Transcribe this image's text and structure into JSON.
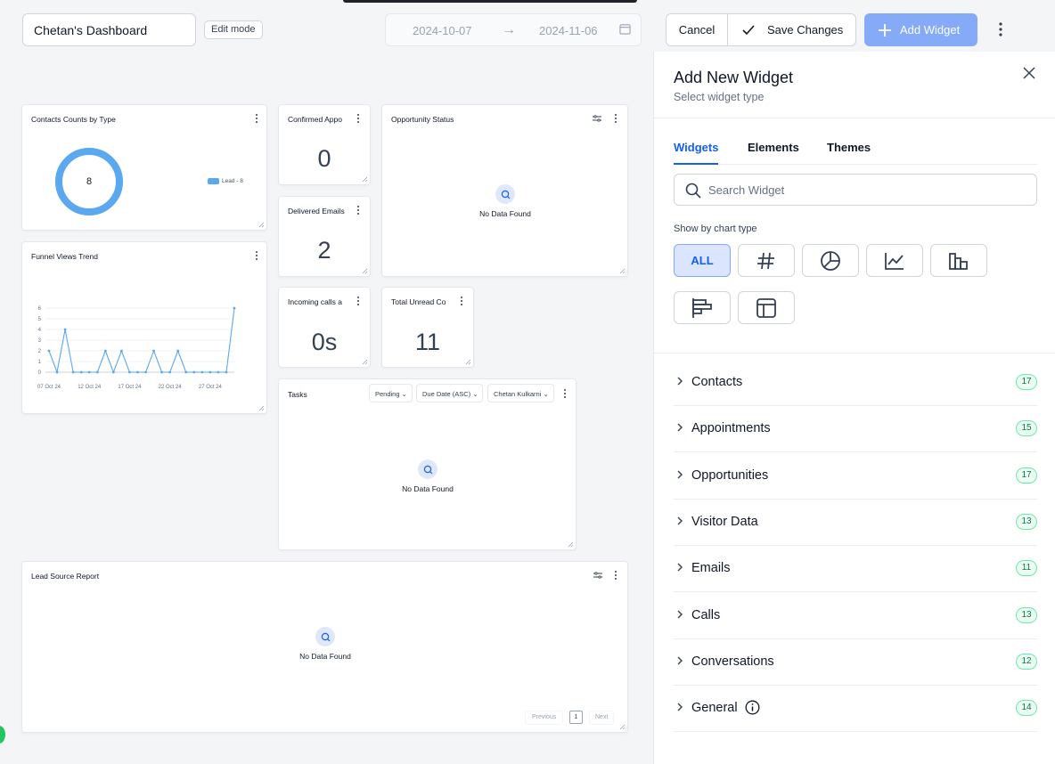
{
  "header": {
    "dashboard_name": "Chetan's Dashboard",
    "edit_mode": "Edit mode",
    "date_start": "2024-10-07",
    "date_end": "2024-11-06",
    "cancel": "Cancel",
    "save": "Save Changes",
    "add_widget": "Add Widget"
  },
  "widgets": {
    "contacts_by_type": {
      "title": "Contacts Counts by Type",
      "total": "8",
      "legend": "Lead - 8"
    },
    "confirmed_appts": {
      "title": "Confirmed Appo",
      "value": "0"
    },
    "opportunity_status": {
      "title": "Opportunity Status",
      "empty": "No Data Found"
    },
    "delivered_emails": {
      "title": "Delivered Emails",
      "value": "2"
    },
    "funnel_views": {
      "title": "Funnel Views Trend"
    },
    "incoming_calls": {
      "title": "Incoming calls a",
      "value": "0s"
    },
    "total_unread": {
      "title": "Total Unread Co",
      "value": "11"
    },
    "tasks": {
      "title": "Tasks",
      "filter_status": "Pending",
      "filter_sort": "Due Date (ASC)",
      "filter_user": "Chetan Kulkarni",
      "empty": "No Data Found"
    },
    "lead_source": {
      "title": "Lead Source Report",
      "empty": "No Data Found",
      "prev": "Previous",
      "page": "1",
      "next": "Next"
    }
  },
  "chart_data": {
    "type": "line",
    "title": "Funnel Views Trend",
    "x": [
      "07 Oct 24",
      "08 Oct 24",
      "09 Oct 24",
      "10 Oct 24",
      "11 Oct 24",
      "12 Oct 24",
      "13 Oct 24",
      "14 Oct 24",
      "15 Oct 24",
      "16 Oct 24",
      "17 Oct 24",
      "18 Oct 24",
      "19 Oct 24",
      "20 Oct 24",
      "21 Oct 24",
      "22 Oct 24",
      "23 Oct 24",
      "24 Oct 24",
      "25 Oct 24",
      "26 Oct 24",
      "27 Oct 24",
      "28 Oct 24",
      "29 Oct 24",
      "30 Oct 24"
    ],
    "series": [
      {
        "values": [
          2,
          0,
          4,
          0,
          0,
          0,
          0,
          2,
          0,
          2,
          0,
          0,
          0,
          2,
          0,
          0,
          2,
          0,
          0,
          0,
          0,
          0,
          0,
          6
        ]
      }
    ],
    "xticks": [
      "07 Oct 24",
      "12 Oct 24",
      "17 Oct 24",
      "22 Oct 24",
      "27 Oct 24"
    ],
    "yticks": [
      0,
      1,
      2,
      3,
      4,
      5,
      6
    ],
    "ylim": [
      0,
      6
    ],
    "grid": true,
    "color": "#5aa9f0"
  },
  "panel": {
    "title": "Add New Widget",
    "subtitle": "Select widget type",
    "tabs": [
      "Widgets",
      "Elements",
      "Themes"
    ],
    "search_placeholder": "Search Widget",
    "show_by": "Show by chart type",
    "chart_types": [
      "ALL",
      "number-icon",
      "pie-icon",
      "line-icon",
      "bar-icon",
      "horizontal-bar-icon",
      "table-icon"
    ],
    "categories": [
      {
        "label": "Contacts",
        "count": "17"
      },
      {
        "label": "Appointments",
        "count": "15"
      },
      {
        "label": "Opportunities",
        "count": "17"
      },
      {
        "label": "Visitor Data",
        "count": "13"
      },
      {
        "label": "Emails",
        "count": "11"
      },
      {
        "label": "Calls",
        "count": "13"
      },
      {
        "label": "Conversations",
        "count": "12"
      },
      {
        "label": "General",
        "count": "14"
      }
    ]
  }
}
